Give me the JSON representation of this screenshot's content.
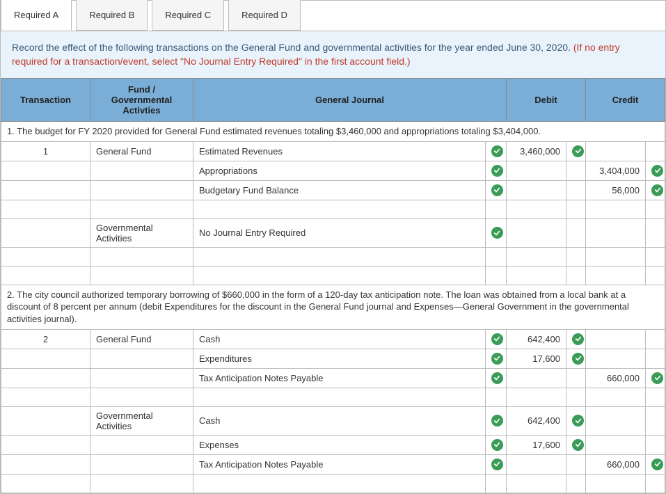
{
  "tabs": [
    {
      "label": "Required A",
      "active": true
    },
    {
      "label": "Required B",
      "active": false
    },
    {
      "label": "Required C",
      "active": false
    },
    {
      "label": "Required D",
      "active": false
    }
  ],
  "instruction": {
    "main": "Record the effect of the following transactions on the General Fund and governmental activities for the year ended June 30, 2020. ",
    "red": "(If no entry required for a transaction/event, select \"No Journal Entry Required\" in the first account field.)"
  },
  "headers": {
    "transaction": "Transaction",
    "fund": "Fund / Governmental Activties",
    "general_journal": "General Journal",
    "debit": "Debit",
    "credit": "Credit"
  },
  "rows": [
    {
      "type": "desc",
      "text": "1. The budget for FY 2020 provided for General Fund estimated revenues totaling $3,460,000 and appropriations totaling $3,404,000."
    },
    {
      "type": "line",
      "trans": "1",
      "fund": "General Fund",
      "journal": "Estimated Revenues",
      "jcheck": true,
      "debit": "3,460,000",
      "dcheck": true,
      "credit": "",
      "ccheck": false
    },
    {
      "type": "line",
      "trans": "",
      "fund": "",
      "journal": "Appropriations",
      "jcheck": true,
      "debit": "",
      "dcheck": false,
      "credit": "3,404,000",
      "ccheck": true
    },
    {
      "type": "line",
      "trans": "",
      "fund": "",
      "journal": "Budgetary Fund Balance",
      "jcheck": true,
      "debit": "",
      "dcheck": false,
      "credit": "56,000",
      "ccheck": true
    },
    {
      "type": "line",
      "trans": "",
      "fund": "",
      "journal": "",
      "jcheck": false,
      "debit": "",
      "dcheck": false,
      "credit": "",
      "ccheck": false
    },
    {
      "type": "line",
      "trans": "",
      "fund": "Governmental Activities",
      "journal": "No Journal Entry Required",
      "jcheck": true,
      "debit": "",
      "dcheck": false,
      "credit": "",
      "ccheck": false
    },
    {
      "type": "line",
      "trans": "",
      "fund": "",
      "journal": "",
      "jcheck": false,
      "debit": "",
      "dcheck": false,
      "credit": "",
      "ccheck": false
    },
    {
      "type": "line",
      "trans": "",
      "fund": "",
      "journal": "",
      "jcheck": false,
      "debit": "",
      "dcheck": false,
      "credit": "",
      "ccheck": false
    },
    {
      "type": "desc",
      "text": "2. The city council authorized temporary borrowing of $660,000 in the form of a 120-day tax anticipation note. The loan was obtained from a local bank at a discount of 8 percent per annum (debit Expenditures for the discount in the General Fund journal and Expenses—General Government in the governmental activities journal)."
    },
    {
      "type": "line",
      "trans": "2",
      "fund": "General Fund",
      "journal": "Cash",
      "jcheck": true,
      "debit": "642,400",
      "dcheck": true,
      "credit": "",
      "ccheck": false
    },
    {
      "type": "line",
      "trans": "",
      "fund": "",
      "journal": "Expenditures",
      "jcheck": true,
      "debit": "17,600",
      "dcheck": true,
      "credit": "",
      "ccheck": false
    },
    {
      "type": "line",
      "trans": "",
      "fund": "",
      "journal": "Tax Anticipation Notes Payable",
      "jcheck": true,
      "debit": "",
      "dcheck": false,
      "credit": "660,000",
      "ccheck": true
    },
    {
      "type": "line",
      "trans": "",
      "fund": "",
      "journal": "",
      "jcheck": false,
      "debit": "",
      "dcheck": false,
      "credit": "",
      "ccheck": false
    },
    {
      "type": "line",
      "trans": "",
      "fund": "Governmental Activities",
      "journal": "Cash",
      "jcheck": true,
      "debit": "642,400",
      "dcheck": true,
      "credit": "",
      "ccheck": false
    },
    {
      "type": "line",
      "trans": "",
      "fund": "",
      "journal": "Expenses",
      "jcheck": true,
      "debit": "17,600",
      "dcheck": true,
      "credit": "",
      "ccheck": false
    },
    {
      "type": "line",
      "trans": "",
      "fund": "",
      "journal": "Tax Anticipation Notes Payable",
      "jcheck": true,
      "debit": "",
      "dcheck": false,
      "credit": "660,000",
      "ccheck": true
    },
    {
      "type": "line",
      "trans": "",
      "fund": "",
      "journal": "",
      "jcheck": false,
      "debit": "",
      "dcheck": false,
      "credit": "",
      "ccheck": false
    }
  ]
}
